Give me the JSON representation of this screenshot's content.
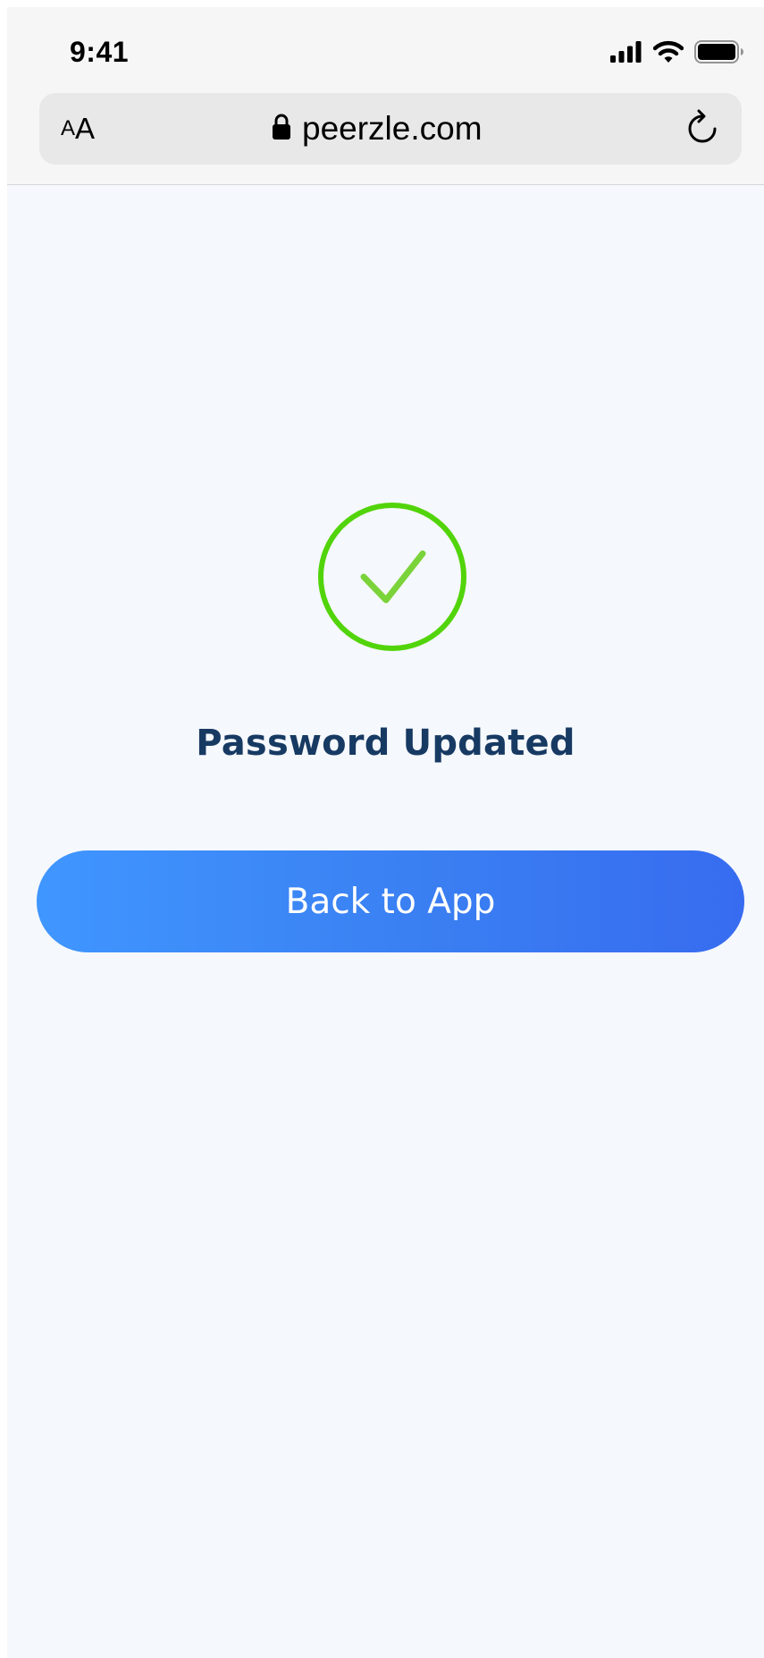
{
  "status_bar": {
    "time": "9:41",
    "icons": [
      "cellular-signal-icon",
      "wifi-icon",
      "battery-icon"
    ]
  },
  "browser": {
    "text_size_small": "A",
    "text_size_large": "A",
    "url": "peerzle.com",
    "secure_icon": "lock-icon",
    "reload_icon": "reload-icon"
  },
  "main": {
    "status_icon": "check-circle-icon",
    "title": "Password Updated",
    "button_label": "Back to App"
  },
  "colors": {
    "success": "#52d40a",
    "check_stroke": "#7bd33a",
    "title": "#173a63",
    "button_start": "#4096ff",
    "button_end": "#376cf0",
    "page_background": "#f5f8fc",
    "chrome_background": "#f6f6f6"
  }
}
